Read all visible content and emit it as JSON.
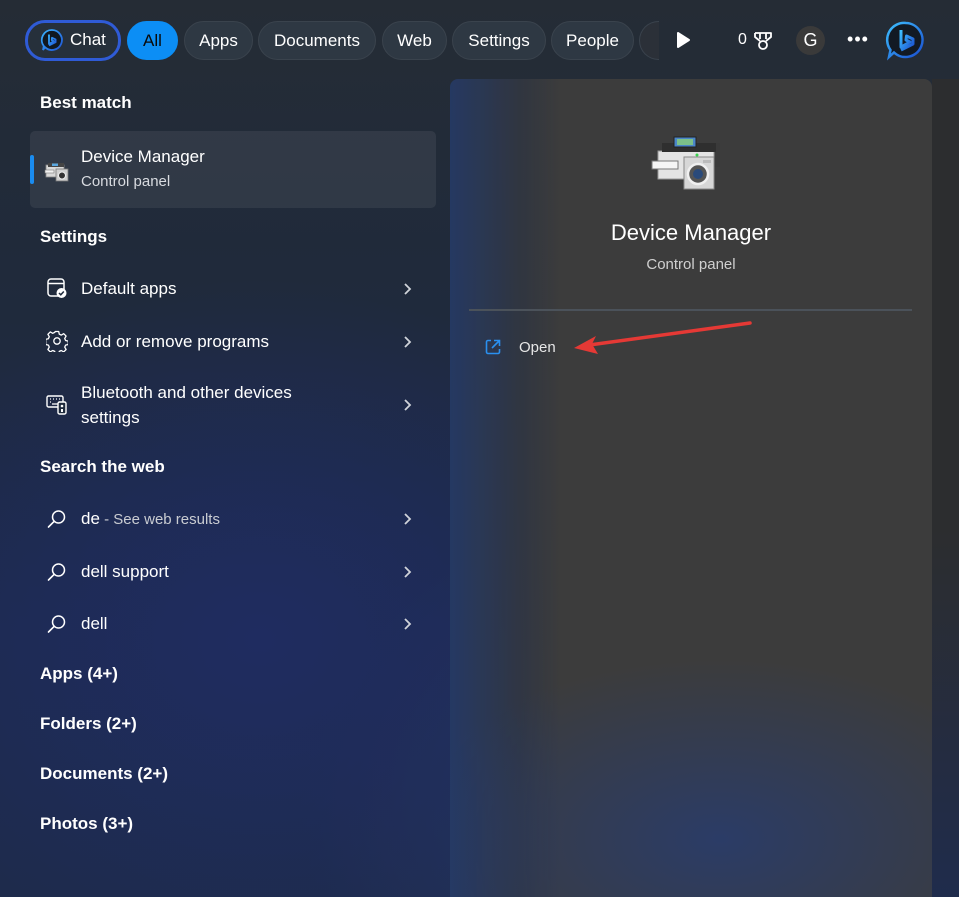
{
  "topbar": {
    "chat_label": "Chat",
    "filters": [
      {
        "label": "All",
        "active": true
      },
      {
        "label": "Apps",
        "active": false
      },
      {
        "label": "Documents",
        "active": false
      },
      {
        "label": "Web",
        "active": false
      },
      {
        "label": "Settings",
        "active": false
      },
      {
        "label": "People",
        "active": false
      }
    ],
    "rewards_count": "0",
    "avatar_initial": "G",
    "more_label": "•••",
    "icons": {
      "play": "play-icon",
      "rewards": "medal-icon",
      "bing": "bing-chat-icon"
    }
  },
  "left": {
    "best_match": {
      "heading": "Best match",
      "title": "Device Manager",
      "subtitle": "Control panel"
    },
    "settings": {
      "heading": "Settings",
      "items": [
        {
          "label": "Default apps",
          "icon": "default-apps-icon"
        },
        {
          "label": "Add or remove programs",
          "icon": "gear-icon"
        },
        {
          "label_line1": "Bluetooth and other devices",
          "label_line2": "settings",
          "icon": "devices-icon"
        }
      ]
    },
    "web": {
      "heading": "Search the web",
      "items": [
        {
          "label": "de",
          "suffix": " - See web results"
        },
        {
          "label": "dell support"
        },
        {
          "label": "dell"
        }
      ]
    },
    "categories": [
      "Apps (4+)",
      "Folders (2+)",
      "Documents (2+)",
      "Photos (3+)"
    ]
  },
  "preview": {
    "title": "Device Manager",
    "subtitle": "Control panel",
    "actions": [
      {
        "label": "Open",
        "icon": "open-external-icon"
      }
    ]
  },
  "colors": {
    "accent": "#0c8ef5",
    "chat_border": "#2f5bd6",
    "annotation_arrow": "#e53935"
  }
}
